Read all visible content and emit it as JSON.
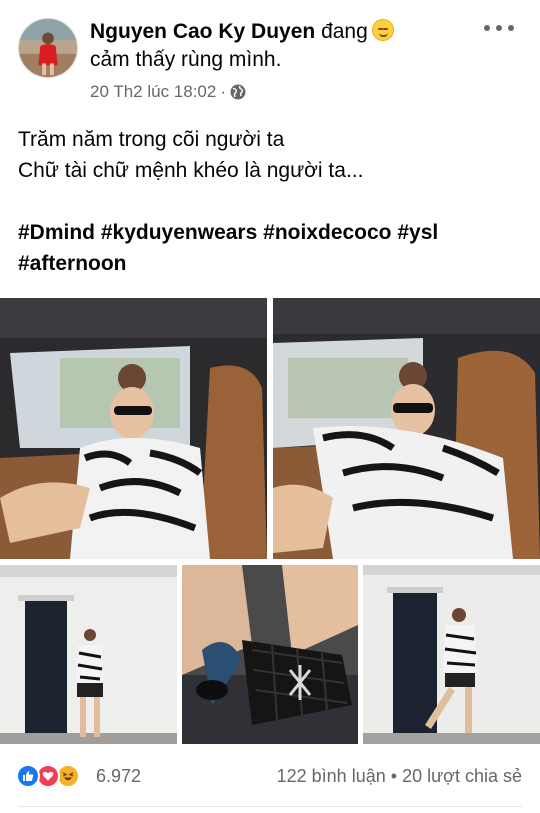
{
  "post": {
    "author": "Nguyen Cao Ky Duyen",
    "feeling_verb": "đang",
    "feeling_text": "cảm thấy rùng mình.",
    "timestamp": "20 Th2 lúc 18:02",
    "meta_separator": "·",
    "audience_icon": "globe-icon",
    "more_icon": "more-options-icon",
    "text_line_1": "Trăm năm trong cõi người ta",
    "text_line_2": "Chữ tài chữ mệnh khéo là người ta...",
    "hashtags": [
      "#Dmind",
      "#kyduyenwears",
      "#noixdecoco",
      "#ysl",
      "#afternoon"
    ]
  },
  "reactions": {
    "types": [
      "like",
      "love",
      "haha"
    ],
    "count": "6.972",
    "comments": "122 bình luận",
    "separator": "•",
    "shares": "20 lượt chia sẻ"
  },
  "colors": {
    "text": "#050505",
    "muted": "#65676b",
    "like": "#1877f2",
    "love": "#f33e58",
    "haha": "#f7b125"
  }
}
